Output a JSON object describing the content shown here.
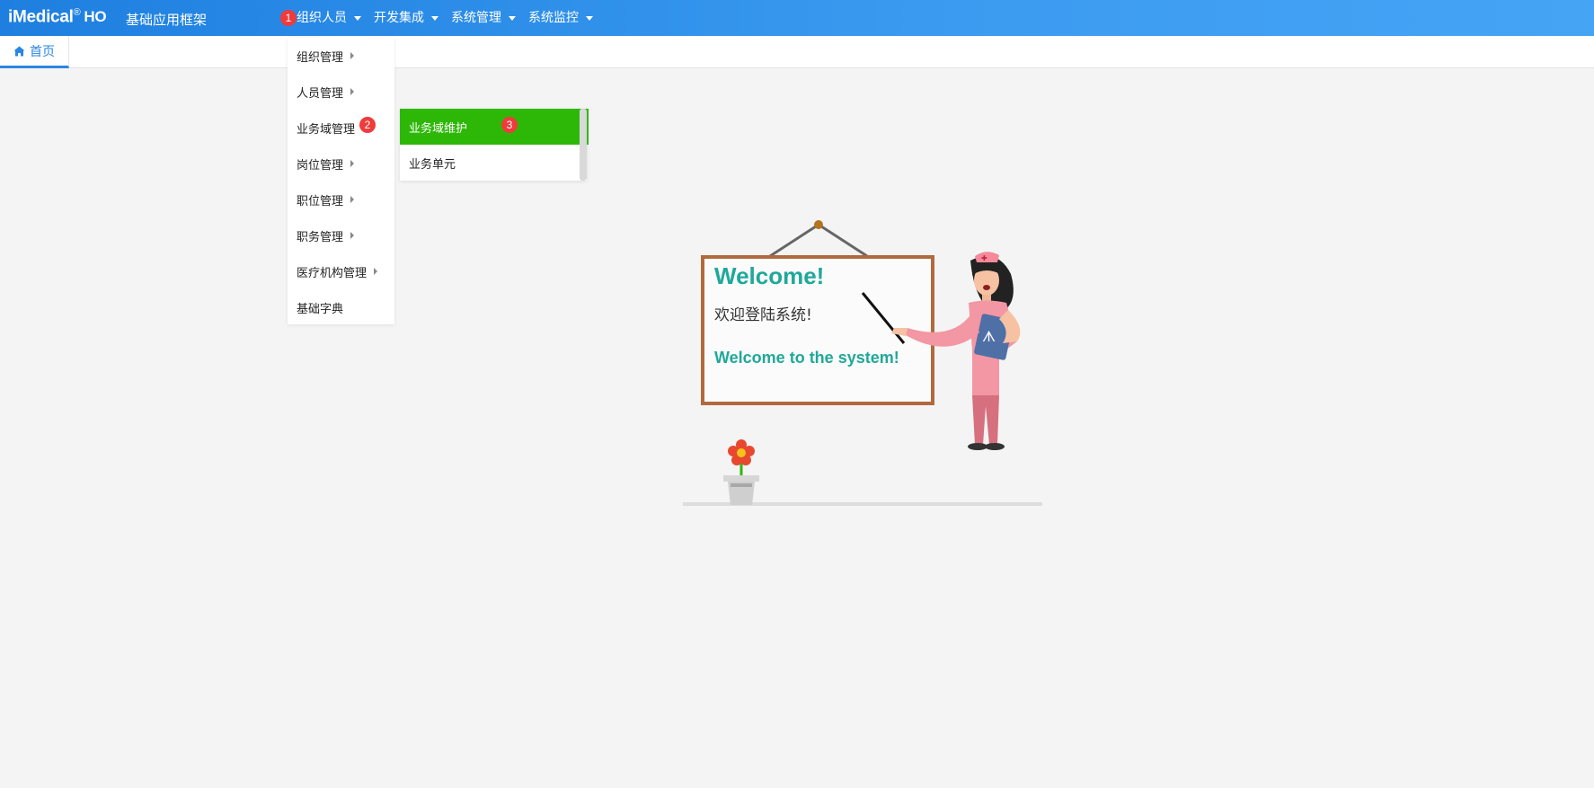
{
  "header": {
    "brand": "iMedical",
    "brand_sup": "®",
    "brand_suffix": "HO",
    "app_title": "基础应用框架",
    "nav": [
      {
        "label": "组织人员"
      },
      {
        "label": "开发集成"
      },
      {
        "label": "系统管理"
      },
      {
        "label": "系统监控"
      }
    ]
  },
  "tabs": [
    {
      "label": "首页",
      "icon": "home-icon"
    }
  ],
  "dropdown": {
    "items": [
      {
        "label": "组织管理"
      },
      {
        "label": "人员管理"
      },
      {
        "label": "业务域管理"
      },
      {
        "label": "岗位管理"
      },
      {
        "label": "职位管理"
      },
      {
        "label": "职务管理"
      },
      {
        "label": "医疗机构管理"
      },
      {
        "label": "基础字典"
      }
    ]
  },
  "submenu": {
    "items": [
      {
        "label": "业务域维护",
        "active": true
      },
      {
        "label": "业务单元"
      }
    ]
  },
  "badges": {
    "b1": "1",
    "b2": "2",
    "b3": "3"
  },
  "welcome": {
    "title": "Welcome!",
    "cn": "欢迎登陆系统!",
    "en": "Welcome to the system!"
  },
  "colors": {
    "header_start": "#1e7fe0",
    "header_end": "#46a4f5",
    "active_submenu": "#2db808",
    "badge": "#ef3b3b",
    "welcome_text": "#20a89a"
  }
}
